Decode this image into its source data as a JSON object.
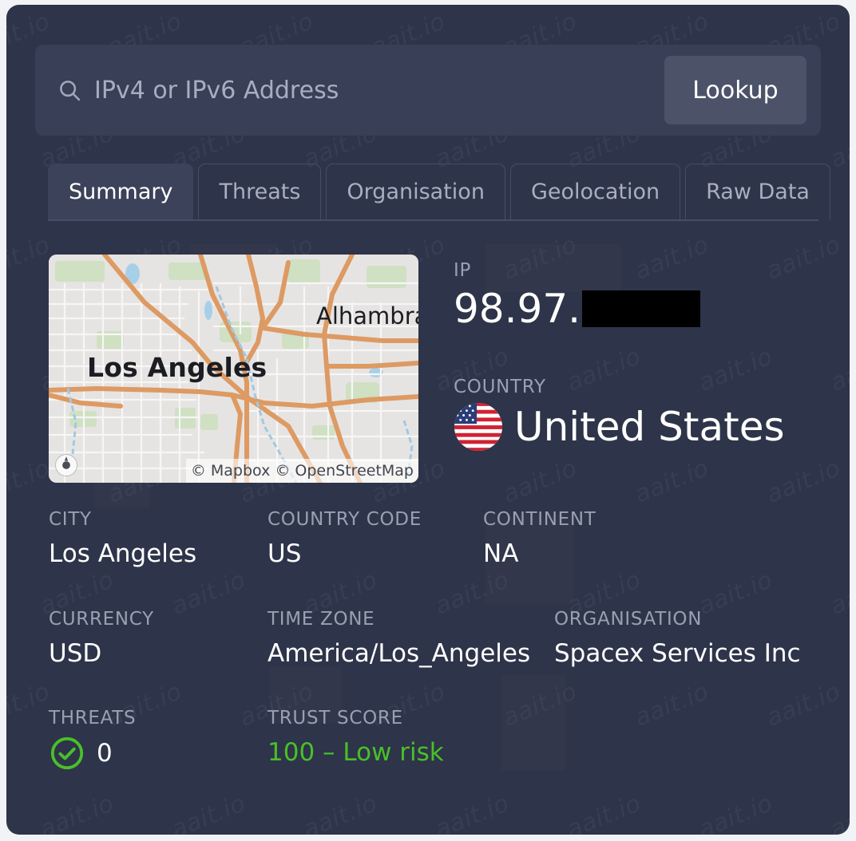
{
  "search": {
    "placeholder": "IPv4 or IPv6 Address",
    "value": "",
    "icon": "search-icon",
    "button_label": "Lookup"
  },
  "tabs": [
    {
      "label": "Summary",
      "active": true
    },
    {
      "label": "Threats",
      "active": false
    },
    {
      "label": "Organisation",
      "active": false
    },
    {
      "label": "Geolocation",
      "active": false
    },
    {
      "label": "Raw Data",
      "active": false
    }
  ],
  "map": {
    "city_label": "Los Angeles",
    "place_label": "Alhambra",
    "attribution": "© Mapbox © OpenStreetMap",
    "compass_icon": "compass-icon"
  },
  "summary": {
    "ip": {
      "label": "IP",
      "value": "98.97.",
      "redacted": true
    },
    "country": {
      "label": "COUNTRY",
      "value": "United States",
      "flag_icon": "flag-us-icon"
    },
    "city": {
      "label": "CITY",
      "value": "Los Angeles"
    },
    "country_code": {
      "label": "COUNTRY CODE",
      "value": "US"
    },
    "continent": {
      "label": "CONTINENT",
      "value": "NA"
    },
    "currency": {
      "label": "CURRENCY",
      "value": "USD"
    },
    "time_zone": {
      "label": "TIME ZONE",
      "value": "America/Los_Angeles"
    },
    "organisation": {
      "label": "ORGANISATION",
      "value": "Spacex Services Inc"
    },
    "threats": {
      "label": "THREATS",
      "value": "0",
      "icon": "check-circle-icon"
    },
    "trust_score": {
      "label": "TRUST SCORE",
      "value": "100 – Low risk"
    }
  },
  "watermark": {
    "text": "aait.io"
  },
  "colors": {
    "page_background": "#f2f3f7",
    "card_background": "#2e3449",
    "search_background": "#393f56",
    "button_background": "#4c5369",
    "active_tab_background": "#3c4259",
    "label_text": "#9aa0b4",
    "value_text": "#ffffff",
    "accent_green": "#49c029",
    "redaction": "#000000"
  }
}
